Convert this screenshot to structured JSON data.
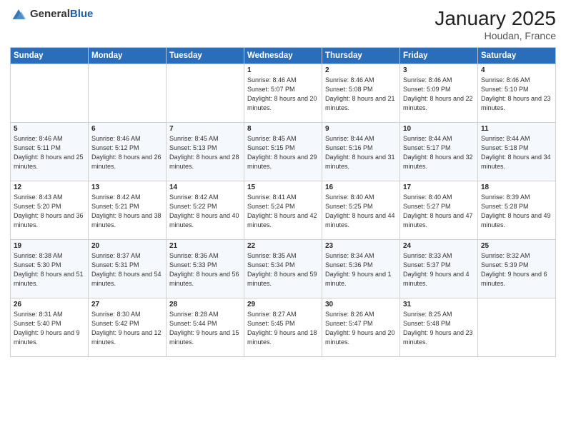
{
  "logo": {
    "general": "General",
    "blue": "Blue"
  },
  "header": {
    "month": "January 2025",
    "location": "Houdan, France"
  },
  "weekdays": [
    "Sunday",
    "Monday",
    "Tuesday",
    "Wednesday",
    "Thursday",
    "Friday",
    "Saturday"
  ],
  "weeks": [
    [
      {
        "day": "",
        "sunrise": "",
        "sunset": "",
        "daylight": ""
      },
      {
        "day": "",
        "sunrise": "",
        "sunset": "",
        "daylight": ""
      },
      {
        "day": "",
        "sunrise": "",
        "sunset": "",
        "daylight": ""
      },
      {
        "day": "1",
        "sunrise": "Sunrise: 8:46 AM",
        "sunset": "Sunset: 5:07 PM",
        "daylight": "Daylight: 8 hours and 20 minutes."
      },
      {
        "day": "2",
        "sunrise": "Sunrise: 8:46 AM",
        "sunset": "Sunset: 5:08 PM",
        "daylight": "Daylight: 8 hours and 21 minutes."
      },
      {
        "day": "3",
        "sunrise": "Sunrise: 8:46 AM",
        "sunset": "Sunset: 5:09 PM",
        "daylight": "Daylight: 8 hours and 22 minutes."
      },
      {
        "day": "4",
        "sunrise": "Sunrise: 8:46 AM",
        "sunset": "Sunset: 5:10 PM",
        "daylight": "Daylight: 8 hours and 23 minutes."
      }
    ],
    [
      {
        "day": "5",
        "sunrise": "Sunrise: 8:46 AM",
        "sunset": "Sunset: 5:11 PM",
        "daylight": "Daylight: 8 hours and 25 minutes."
      },
      {
        "day": "6",
        "sunrise": "Sunrise: 8:46 AM",
        "sunset": "Sunset: 5:12 PM",
        "daylight": "Daylight: 8 hours and 26 minutes."
      },
      {
        "day": "7",
        "sunrise": "Sunrise: 8:45 AM",
        "sunset": "Sunset: 5:13 PM",
        "daylight": "Daylight: 8 hours and 28 minutes."
      },
      {
        "day": "8",
        "sunrise": "Sunrise: 8:45 AM",
        "sunset": "Sunset: 5:15 PM",
        "daylight": "Daylight: 8 hours and 29 minutes."
      },
      {
        "day": "9",
        "sunrise": "Sunrise: 8:44 AM",
        "sunset": "Sunset: 5:16 PM",
        "daylight": "Daylight: 8 hours and 31 minutes."
      },
      {
        "day": "10",
        "sunrise": "Sunrise: 8:44 AM",
        "sunset": "Sunset: 5:17 PM",
        "daylight": "Daylight: 8 hours and 32 minutes."
      },
      {
        "day": "11",
        "sunrise": "Sunrise: 8:44 AM",
        "sunset": "Sunset: 5:18 PM",
        "daylight": "Daylight: 8 hours and 34 minutes."
      }
    ],
    [
      {
        "day": "12",
        "sunrise": "Sunrise: 8:43 AM",
        "sunset": "Sunset: 5:20 PM",
        "daylight": "Daylight: 8 hours and 36 minutes."
      },
      {
        "day": "13",
        "sunrise": "Sunrise: 8:42 AM",
        "sunset": "Sunset: 5:21 PM",
        "daylight": "Daylight: 8 hours and 38 minutes."
      },
      {
        "day": "14",
        "sunrise": "Sunrise: 8:42 AM",
        "sunset": "Sunset: 5:22 PM",
        "daylight": "Daylight: 8 hours and 40 minutes."
      },
      {
        "day": "15",
        "sunrise": "Sunrise: 8:41 AM",
        "sunset": "Sunset: 5:24 PM",
        "daylight": "Daylight: 8 hours and 42 minutes."
      },
      {
        "day": "16",
        "sunrise": "Sunrise: 8:40 AM",
        "sunset": "Sunset: 5:25 PM",
        "daylight": "Daylight: 8 hours and 44 minutes."
      },
      {
        "day": "17",
        "sunrise": "Sunrise: 8:40 AM",
        "sunset": "Sunset: 5:27 PM",
        "daylight": "Daylight: 8 hours and 47 minutes."
      },
      {
        "day": "18",
        "sunrise": "Sunrise: 8:39 AM",
        "sunset": "Sunset: 5:28 PM",
        "daylight": "Daylight: 8 hours and 49 minutes."
      }
    ],
    [
      {
        "day": "19",
        "sunrise": "Sunrise: 8:38 AM",
        "sunset": "Sunset: 5:30 PM",
        "daylight": "Daylight: 8 hours and 51 minutes."
      },
      {
        "day": "20",
        "sunrise": "Sunrise: 8:37 AM",
        "sunset": "Sunset: 5:31 PM",
        "daylight": "Daylight: 8 hours and 54 minutes."
      },
      {
        "day": "21",
        "sunrise": "Sunrise: 8:36 AM",
        "sunset": "Sunset: 5:33 PM",
        "daylight": "Daylight: 8 hours and 56 minutes."
      },
      {
        "day": "22",
        "sunrise": "Sunrise: 8:35 AM",
        "sunset": "Sunset: 5:34 PM",
        "daylight": "Daylight: 8 hours and 59 minutes."
      },
      {
        "day": "23",
        "sunrise": "Sunrise: 8:34 AM",
        "sunset": "Sunset: 5:36 PM",
        "daylight": "Daylight: 9 hours and 1 minute."
      },
      {
        "day": "24",
        "sunrise": "Sunrise: 8:33 AM",
        "sunset": "Sunset: 5:37 PM",
        "daylight": "Daylight: 9 hours and 4 minutes."
      },
      {
        "day": "25",
        "sunrise": "Sunrise: 8:32 AM",
        "sunset": "Sunset: 5:39 PM",
        "daylight": "Daylight: 9 hours and 6 minutes."
      }
    ],
    [
      {
        "day": "26",
        "sunrise": "Sunrise: 8:31 AM",
        "sunset": "Sunset: 5:40 PM",
        "daylight": "Daylight: 9 hours and 9 minutes."
      },
      {
        "day": "27",
        "sunrise": "Sunrise: 8:30 AM",
        "sunset": "Sunset: 5:42 PM",
        "daylight": "Daylight: 9 hours and 12 minutes."
      },
      {
        "day": "28",
        "sunrise": "Sunrise: 8:28 AM",
        "sunset": "Sunset: 5:44 PM",
        "daylight": "Daylight: 9 hours and 15 minutes."
      },
      {
        "day": "29",
        "sunrise": "Sunrise: 8:27 AM",
        "sunset": "Sunset: 5:45 PM",
        "daylight": "Daylight: 9 hours and 18 minutes."
      },
      {
        "day": "30",
        "sunrise": "Sunrise: 8:26 AM",
        "sunset": "Sunset: 5:47 PM",
        "daylight": "Daylight: 9 hours and 20 minutes."
      },
      {
        "day": "31",
        "sunrise": "Sunrise: 8:25 AM",
        "sunset": "Sunset: 5:48 PM",
        "daylight": "Daylight: 9 hours and 23 minutes."
      },
      {
        "day": "",
        "sunrise": "",
        "sunset": "",
        "daylight": ""
      }
    ]
  ]
}
